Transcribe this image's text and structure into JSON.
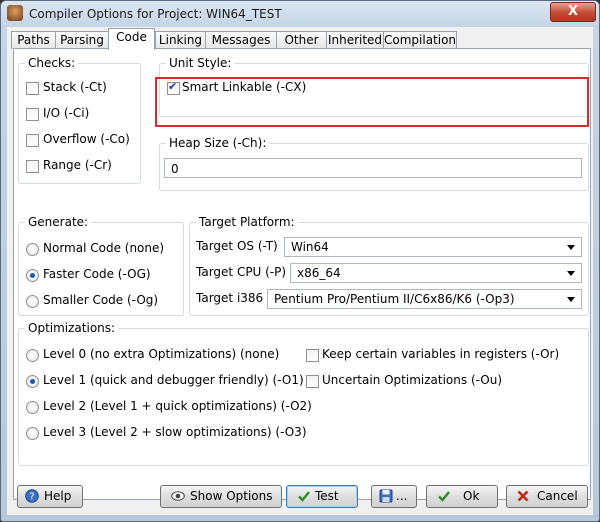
{
  "window": {
    "title": "Compiler Options for Project: WIN64_TEST",
    "close_label": "X"
  },
  "tabs": [
    "Paths",
    "Parsing",
    "Code",
    "Linking",
    "Messages",
    "Other",
    "Inherited",
    "Compilation"
  ],
  "active_tab": "Code",
  "checks": {
    "label": "Checks:",
    "items": [
      {
        "label": "Stack (-Ct)",
        "checked": false
      },
      {
        "label": "I/O (-Ci)",
        "checked": false
      },
      {
        "label": "Overflow (-Co)",
        "checked": false
      },
      {
        "label": "Range (-Cr)",
        "checked": false
      }
    ]
  },
  "unit_style": {
    "label": "Unit Style:",
    "smart_linkable": {
      "label": "Smart Linkable (-CX)",
      "checked": true
    }
  },
  "heap_size": {
    "label": "Heap Size (-Ch):",
    "value": "0"
  },
  "generate": {
    "label": "Generate:",
    "items": [
      {
        "label": "Normal Code (none)",
        "selected": false
      },
      {
        "label": "Faster Code (-OG)",
        "selected": true
      },
      {
        "label": "Smaller Code (-Og)",
        "selected": false
      }
    ]
  },
  "target_platform": {
    "label": "Target Platform:",
    "os": {
      "label": "Target OS (-T)",
      "value": "Win64"
    },
    "cpu": {
      "label": "Target CPU (-P)",
      "value": "x86_64"
    },
    "i386": {
      "label": "Target i386",
      "value": "Pentium Pro/Pentium II/C6x86/K6 (-Op3)"
    }
  },
  "optimizations": {
    "label": "Optimizations:",
    "levels": [
      {
        "label": "Level 0 (no extra Optimizations) (none)",
        "selected": false
      },
      {
        "label": "Level 1 (quick and debugger friendly) (-O1)",
        "selected": true
      },
      {
        "label": "Level 2 (Level 1 + quick optimizations) (-O2)",
        "selected": false
      },
      {
        "label": "Level 3 (Level 2 + slow optimizations) (-O3)",
        "selected": false
      }
    ],
    "options": [
      {
        "label": "Keep certain variables in registers (-Or)",
        "checked": false
      },
      {
        "label": "Uncertain Optimizations (-Ou)",
        "checked": false
      }
    ]
  },
  "buttons": {
    "help": "Help",
    "show_options": "Show Options",
    "test": "Test",
    "save": "...",
    "ok": "Ok",
    "cancel": "Cancel"
  }
}
